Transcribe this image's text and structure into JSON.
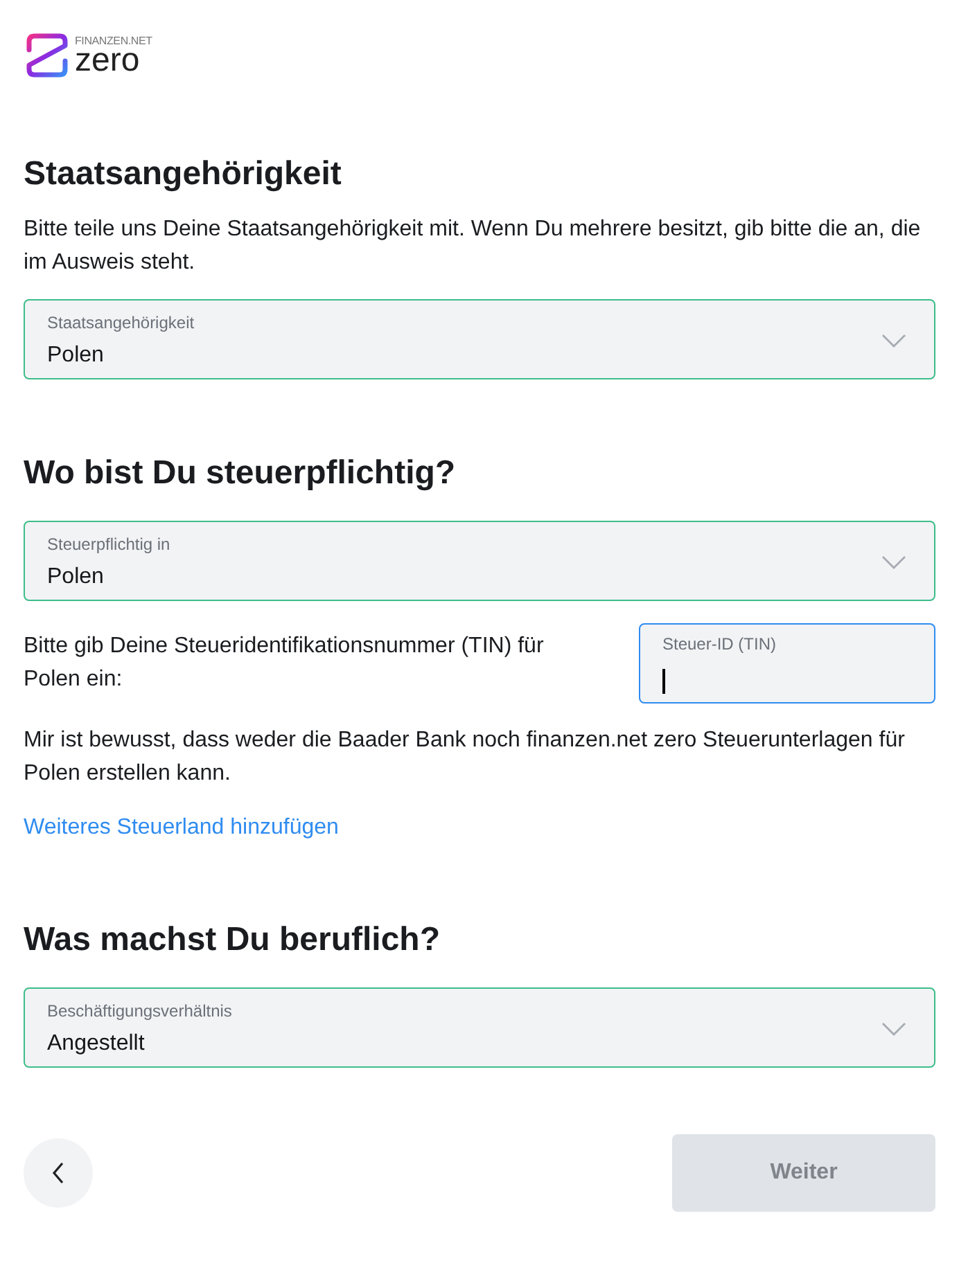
{
  "logo": {
    "brand": "FINANZEN.NET",
    "product": "zero"
  },
  "nationality": {
    "heading": "Staatsangehörigkeit",
    "text": "Bitte teile uns Deine Staatsangehörigkeit mit. Wenn Du mehrere besitzt, gib bitte die an, die im Ausweis steht.",
    "select": {
      "label": "Staatsangehörigkeit",
      "value": "Polen",
      "valid": true
    }
  },
  "tax": {
    "heading": "Wo bist Du steuerpflichtig?",
    "select": {
      "label": "Steuerpflichtig in",
      "value": "Polen",
      "valid": true
    },
    "tin_prompt": "Bitte gib Deine Steueridentifikationsnummer (TIN) für Polen ein:",
    "tin_field": {
      "label": "Steuer-ID (TIN)",
      "focused": true
    },
    "notice": "Mir ist bewusst, dass weder die Baader Bank noch finanzen.net zero Steuerunterlagen für Polen erstellen kann.",
    "add_link": "Weiteres Steuerland hinzufügen"
  },
  "job": {
    "heading": "Was machst Du beruflich?",
    "select": {
      "label": "Beschäftigungsverhältnis",
      "value": "Angestellt",
      "valid": true
    }
  },
  "nav": {
    "next": {
      "label": "Weiter",
      "disabled": true
    }
  }
}
